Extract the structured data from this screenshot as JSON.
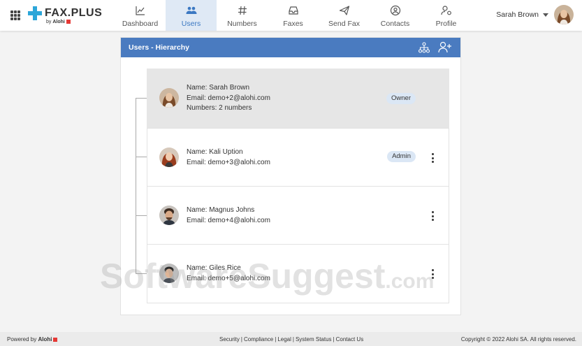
{
  "brand": {
    "name": "FAX.PLUS",
    "by": "by",
    "company": "Alohi",
    "accent": "#3b78c2",
    "logo_color": "#2ca6d9"
  },
  "nav": {
    "items": [
      {
        "label": "Dashboard",
        "icon": "chart-line-icon",
        "active": false
      },
      {
        "label": "Users",
        "icon": "users-icon",
        "active": true
      },
      {
        "label": "Numbers",
        "icon": "hash-icon",
        "active": false
      },
      {
        "label": "Faxes",
        "icon": "inbox-icon",
        "active": false
      },
      {
        "label": "Send Fax",
        "icon": "paper-plane-icon",
        "active": false
      },
      {
        "label": "Contacts",
        "icon": "contact-icon",
        "active": false
      },
      {
        "label": "Profile",
        "icon": "profile-settings-icon",
        "active": false
      }
    ]
  },
  "user_menu": {
    "name": "Sarah Brown"
  },
  "panel": {
    "title": "Users - Hierarchy",
    "header_color": "#4a7bc0"
  },
  "users": [
    {
      "name": "Name: Sarah Brown",
      "email": "Email: demo+2@alohi.com",
      "numbers": "Numbers: 2 numbers",
      "role": "Owner",
      "selected": true
    },
    {
      "name": "Name: Kali Uption",
      "email": "Email: demo+3@alohi.com",
      "numbers": "",
      "role": "Admin",
      "selected": false
    },
    {
      "name": "Name: Magnus Johns",
      "email": "Email: demo+4@alohi.com",
      "numbers": "",
      "role": "",
      "selected": false
    },
    {
      "name": "Name: Giles Rice",
      "email": "Email: demo+5@alohi.com",
      "numbers": "",
      "role": "",
      "selected": false
    }
  ],
  "footer": {
    "powered_by": "Powered by",
    "company": "Alohi",
    "links": [
      "Security",
      "Compliance",
      "Legal",
      "System Status",
      "Contact Us"
    ],
    "copyright": "Copyright © 2022 Alohi SA. All rights reserved."
  },
  "watermark": {
    "main": "SoftwareSuggest",
    "suffix": ".com"
  }
}
